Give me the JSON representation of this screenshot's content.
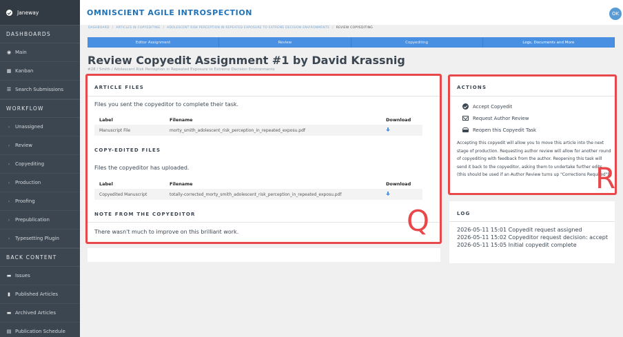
{
  "sidebar": {
    "user": "Janeway",
    "sections": [
      {
        "heading": "DASHBOARDS",
        "items": [
          {
            "label": "Main",
            "icon": "dashboard-icon"
          },
          {
            "label": "Kanban",
            "icon": "kanban-icon"
          },
          {
            "label": "Search Submissions",
            "icon": "list-icon"
          }
        ]
      },
      {
        "heading": "WORKFLOW",
        "items": [
          {
            "label": "Unassigned",
            "icon": "chevron-right-icon"
          },
          {
            "label": "Review",
            "icon": "chevron-right-icon"
          },
          {
            "label": "Copyediting",
            "icon": "chevron-right-icon"
          },
          {
            "label": "Production",
            "icon": "chevron-right-icon"
          },
          {
            "label": "Proofing",
            "icon": "chevron-right-icon"
          },
          {
            "label": "Prepublication",
            "icon": "chevron-right-icon"
          },
          {
            "label": "Typesetting Plugin",
            "icon": "chevron-right-icon"
          }
        ]
      },
      {
        "heading": "BACK CONTENT",
        "items": [
          {
            "label": "Issues",
            "icon": "folder-icon"
          },
          {
            "label": "Published Articles",
            "icon": "file-icon"
          },
          {
            "label": "Archived Articles",
            "icon": "archive-icon"
          },
          {
            "label": "Publication Schedule",
            "icon": "calendar-icon"
          }
        ]
      }
    ]
  },
  "header": {
    "title": "OMNISCIENT AGILE INTROSPECTION",
    "avatar": "OK"
  },
  "breadcrumbs": [
    "DASHBOARD",
    "ARTICLES IN COPYEDITING",
    "ADOLESCENT RISK PERCEPTION IN REPEATED EXPOSURE TO EXTREME DECISION ENVIRONMENTS",
    "REVIEW COPYEDITING"
  ],
  "tabs": [
    "Editor Assignment",
    "Review",
    "Copyediting",
    "Logs, Documents and More"
  ],
  "page": {
    "title": "Review Copyedit Assignment #1 by David Krassnig",
    "subtitle": "#28 / Smith / Adolescent Risk Perception in Repeated Exposure to Extreme Decision Environments"
  },
  "article_files": {
    "heading": "ARTICLE FILES",
    "intro": "Files you sent the copyeditor to complete their task.",
    "columns": [
      "Label",
      "Filename",
      "Download"
    ],
    "rows": [
      {
        "label": "Manuscript File",
        "filename": "morty_smith_adolescent_risk_perception_in_repeated_exposu.pdf"
      }
    ]
  },
  "copyedited_files": {
    "heading": "COPY-EDITED FILES",
    "intro": "Files the copyeditor has uploaded.",
    "columns": [
      "Label",
      "Filename",
      "Download"
    ],
    "rows": [
      {
        "label": "Copyedited Manuscript",
        "filename": "totally-corrected_morty_smith_adolescent_risk_perception_in_repeated_exposu.pdf"
      }
    ]
  },
  "note": {
    "heading": "NOTE FROM THE COPYEDITOR",
    "text": "There wasn't much to improve on this brilliant work."
  },
  "actions": {
    "heading": "ACTIONS",
    "accept": "Accept Copyedit",
    "request": "Request Author Review",
    "reopen": "Reopen this Copyedit Task",
    "description": "Accepting this copyedit will allow you to move this article into the next stage of production. Requesting author review will allow for another round of copyediting with feedback from the author. Reopening this task will send it back to the copyeditor, asking them to undertake further edits (this should be used if an Author Review turns up \"Corrections Required\")."
  },
  "log": {
    "heading": "LOG",
    "entries": [
      "2026-05-11 15:01 Copyedit request assigned",
      "2026-05-11 15:02 Copyeditor request decision: accept",
      "2026-05-11 15:05 Initial copyedit complete"
    ]
  },
  "annotations": {
    "q": "Q",
    "r": "R",
    "color": "#e8484a"
  },
  "colors": {
    "accent": "#4a90e2",
    "sidebar": "#3c4651",
    "title": "#1f72b8"
  }
}
